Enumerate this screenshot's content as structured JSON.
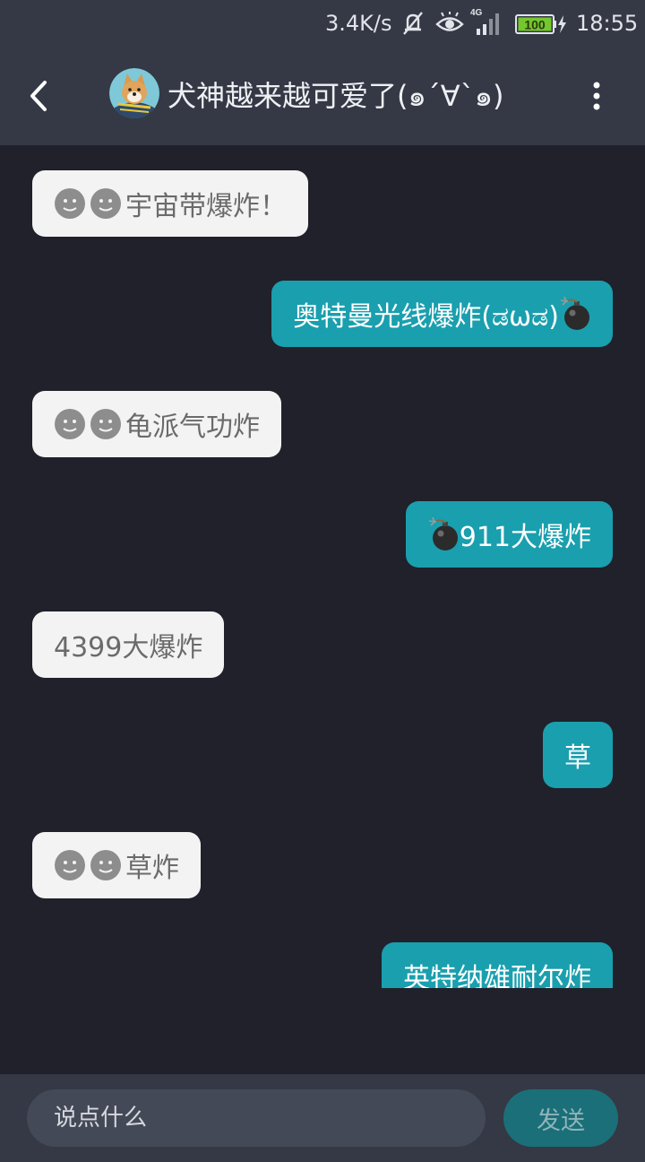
{
  "status_bar": {
    "net_speed": "3.4K/s",
    "battery_level": "100",
    "time": "18:55"
  },
  "header": {
    "title": "犬神越来越可爱了(๑´∀`๑)"
  },
  "messages": [
    {
      "direction": "incoming",
      "text": "宇宙带爆炸！",
      "leading_icons": [
        "face-icon",
        "face-icon"
      ]
    },
    {
      "direction": "outgoing",
      "text": "奥特曼光线爆炸(ಡωಡ) ",
      "trailing_icons": [
        "bomb-icon"
      ]
    },
    {
      "direction": "incoming",
      "text": "龟派气功炸",
      "leading_icons": [
        "face-icon",
        "face-icon"
      ]
    },
    {
      "direction": "outgoing",
      "text": "911大爆炸",
      "leading_icons": [
        "bomb-icon"
      ]
    },
    {
      "direction": "incoming",
      "text": "4399大爆炸"
    },
    {
      "direction": "outgoing",
      "text": "草"
    },
    {
      "direction": "incoming",
      "text": "草炸",
      "leading_icons": [
        "face-icon",
        "face-icon"
      ]
    },
    {
      "direction": "outgoing",
      "text": "英特纳雄耐尔炸"
    }
  ],
  "input_bar": {
    "placeholder": "说点什么",
    "send_label": "发送"
  },
  "colors": {
    "accent": "#1a9fae",
    "background": "#20212b",
    "bar": "#343945"
  }
}
